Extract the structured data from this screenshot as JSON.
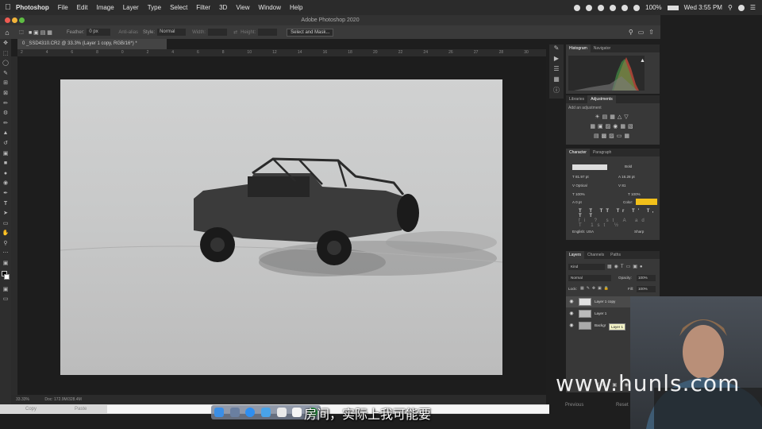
{
  "menubar": {
    "app": "Photoshop",
    "items": [
      "File",
      "Edit",
      "Image",
      "Layer",
      "Type",
      "Select",
      "Filter",
      "3D",
      "View",
      "Window",
      "Help"
    ],
    "battery": "100%",
    "clock": "Wed 3:55 PM"
  },
  "window": {
    "title": "Adobe Photoshop 2020"
  },
  "options": {
    "feather_label": "Feather:",
    "feather_value": "0 px",
    "antialias_label": "Anti-alias",
    "style_label": "Style:",
    "style_value": "Normal",
    "width_label": "Width:",
    "height_label": "Height:",
    "select_mask_button": "Select and Mask..."
  },
  "document": {
    "tab": "0 _SSD4310.CR2 @ 33.3% (Layer 1 copy, RGB/16*) *",
    "ruler_ticks": [
      "2",
      "4",
      "6",
      "8",
      "0",
      "2",
      "4",
      "6",
      "8",
      "10",
      "12",
      "14",
      "16",
      "18",
      "20",
      "22",
      "24",
      "26",
      "27",
      "28",
      "30"
    ],
    "zoom": "33.33%",
    "doc_info": "Doc: 172.9M/328.4M"
  },
  "histogram": {
    "tabs": [
      "Histogram",
      "Navigator"
    ]
  },
  "adjustments": {
    "tabs": [
      "Libraries",
      "Adjustments"
    ],
    "add_label": "Add an adjustment"
  },
  "character": {
    "tabs": [
      "Character",
      "Paragraph"
    ],
    "font_style": "Bold",
    "size": "81.97 pt",
    "leading": "16.28 pt",
    "kerning": "Optical",
    "tracking": "81",
    "vscale": "100%",
    "hscale": "100%",
    "baseline": "0 pt",
    "color_label": "Color:",
    "language": "English: USA",
    "aa": "Sharp",
    "color": "#f2c01a"
  },
  "layers": {
    "tabs": [
      "Layers",
      "Channels",
      "Paths"
    ],
    "kind": "Kind",
    "blend": "Normal",
    "opacity_label": "Opacity:",
    "opacity": "100%",
    "lock_label": "Lock:",
    "fill_label": "Fill:",
    "fill": "100%",
    "items": [
      {
        "name": "Layer 1 copy"
      },
      {
        "name": "Layer 1"
      },
      {
        "name": "Backgr"
      }
    ],
    "tooltip": "Layer 1"
  },
  "history": {
    "previous": "Previous",
    "reset": "Reset"
  },
  "bottom": {
    "copy": "Copy",
    "paste": "Paste"
  },
  "subtitle": "房间，实际上我可能要",
  "watermark": "www.hunls.com"
}
